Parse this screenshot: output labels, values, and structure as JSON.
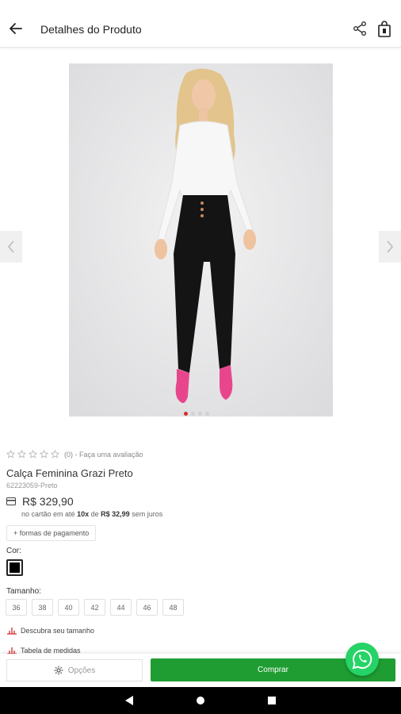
{
  "header": {
    "title": "Detalhes do Produto"
  },
  "gallery": {
    "slides": 4,
    "active_index": 0
  },
  "rating": {
    "stars_filled": 0,
    "stars_total": 5,
    "text": "(0) - Faça uma avaliação"
  },
  "product": {
    "name": "Calça Feminina Grazi Preto",
    "sku": "62223059-Preto",
    "price": "R$ 329,90",
    "installment_prefix": "no cartão em até",
    "installment_count": "10x",
    "installment_mid": "de",
    "installment_value": "R$ 32,99",
    "installment_suffix": "sem juros",
    "payment_link": "+ formas de pagamento"
  },
  "color": {
    "label": "Cor:",
    "selected": "#000000"
  },
  "size": {
    "label": "Tamanho:",
    "options": [
      "36",
      "38",
      "40",
      "42",
      "44",
      "46",
      "48"
    ]
  },
  "links": {
    "size_finder": "Descubra seu tamanho",
    "size_table": "Tabela de medidas"
  },
  "actions": {
    "options_label": "Opções",
    "buy_label": "Comprar"
  },
  "colors": {
    "primary": "#1f9d33",
    "whatsapp": "#25d366",
    "active_dot": "#d32b2b"
  }
}
